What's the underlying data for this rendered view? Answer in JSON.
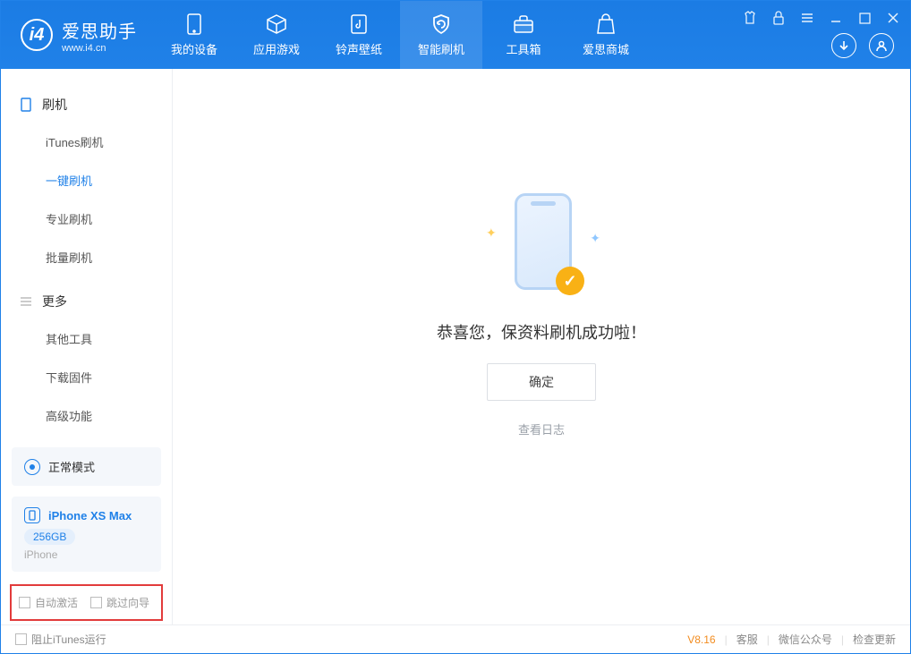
{
  "app": {
    "name": "爱思助手",
    "url": "www.i4.cn"
  },
  "header_tabs": [
    {
      "label": "我的设备"
    },
    {
      "label": "应用游戏"
    },
    {
      "label": "铃声壁纸"
    },
    {
      "label": "智能刷机"
    },
    {
      "label": "工具箱"
    },
    {
      "label": "爱思商城"
    }
  ],
  "sidebar": {
    "section1_title": "刷机",
    "items1": [
      "iTunes刷机",
      "一键刷机",
      "专业刷机",
      "批量刷机"
    ],
    "section2_title": "更多",
    "items2": [
      "其他工具",
      "下载固件",
      "高级功能"
    ],
    "mode_label": "正常模式",
    "device": {
      "name": "iPhone XS Max",
      "storage": "256GB",
      "type": "iPhone"
    },
    "check1": "自动激活",
    "check2": "跳过向导"
  },
  "main": {
    "success_text": "恭喜您，保资料刷机成功啦！",
    "ok_button": "确定",
    "view_log": "查看日志"
  },
  "footer": {
    "block_itunes": "阻止iTunes运行",
    "version": "V8.16",
    "links": [
      "客服",
      "微信公众号",
      "检查更新"
    ]
  }
}
